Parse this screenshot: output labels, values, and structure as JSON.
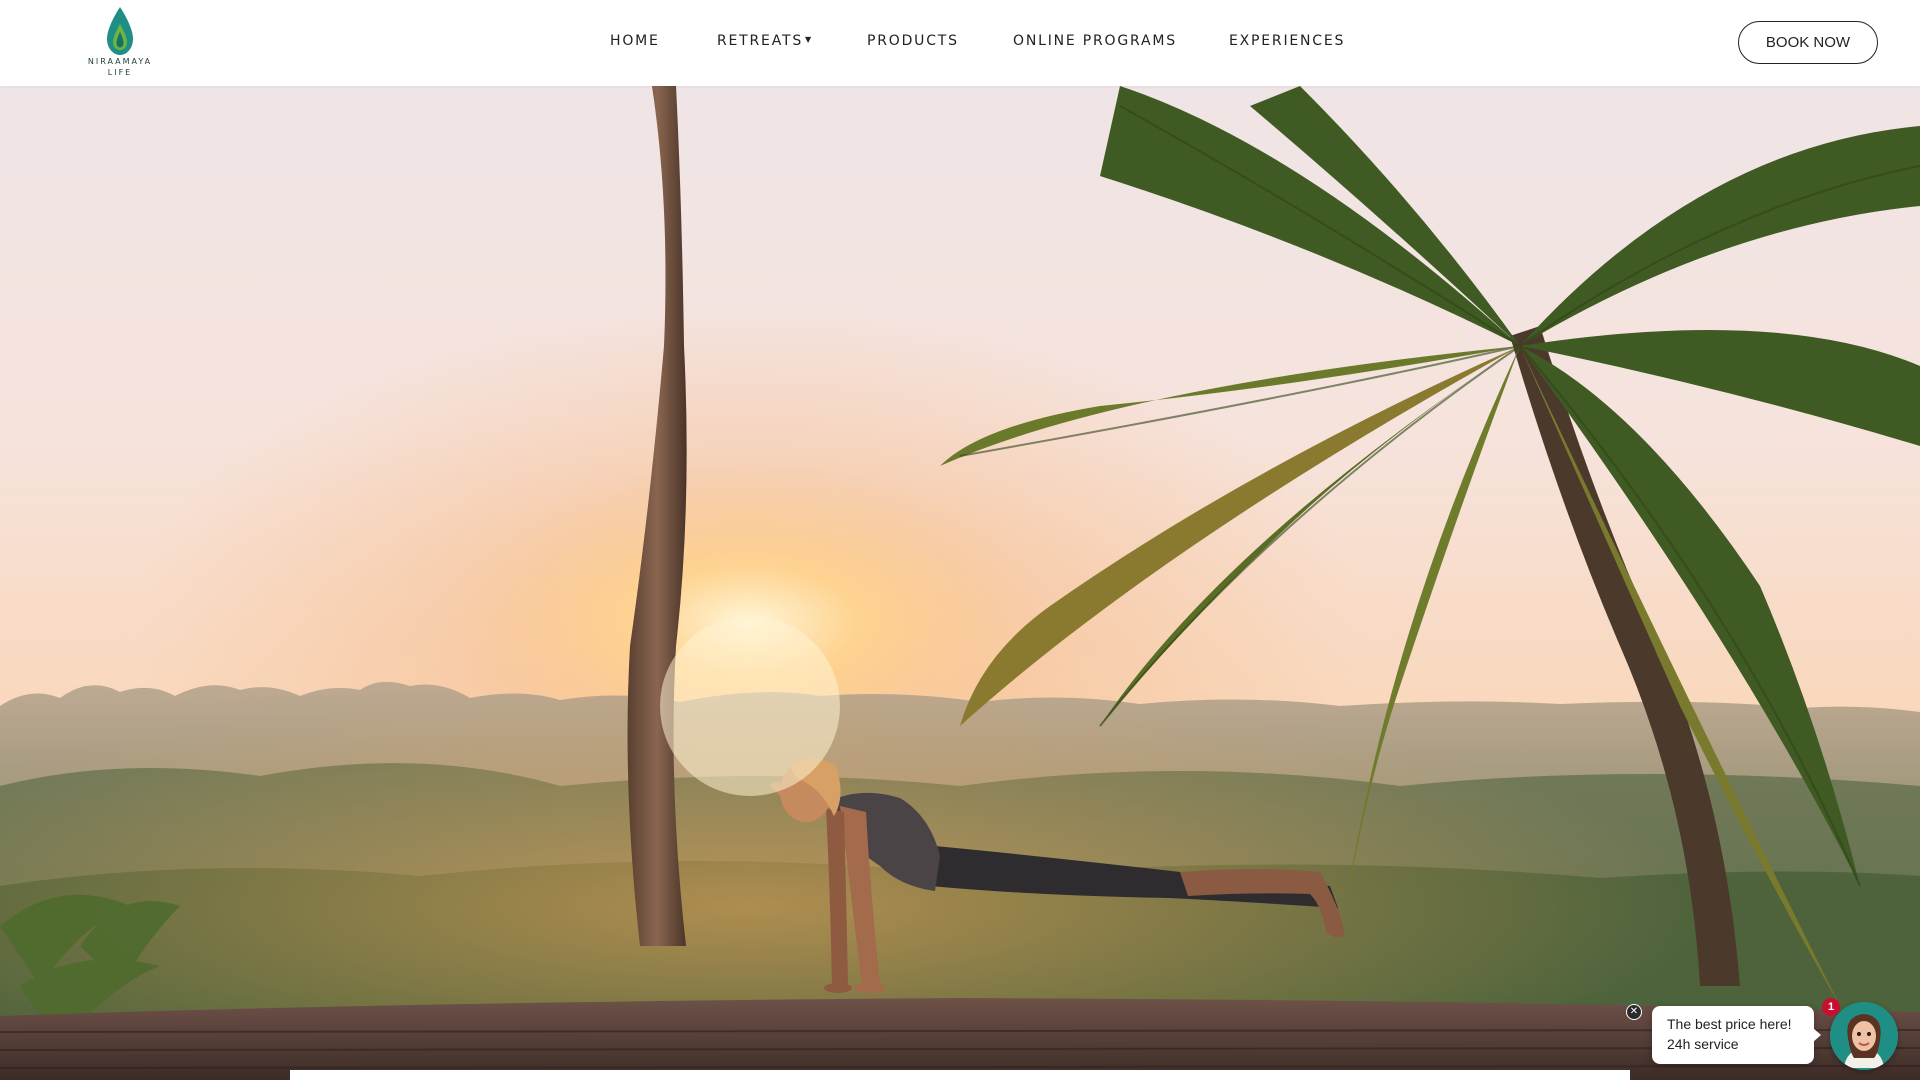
{
  "brand": {
    "name": "NIRAAMAYA",
    "sub": "LIFE",
    "logo_icon": "water-drop-logo",
    "colors": {
      "teal": "#1f8f85",
      "green": "#6db33f"
    }
  },
  "nav": {
    "items": [
      {
        "label": "HOME"
      },
      {
        "label": "RETREATS",
        "has_dropdown": true
      },
      {
        "label": "PRODUCTS"
      },
      {
        "label": "ONLINE PROGRAMS"
      },
      {
        "label": "EXPERIENCES"
      }
    ],
    "dropdown_icon": "caret-down-icon",
    "book_label": "BOOK NOW"
  },
  "hero": {
    "scene": "yoga at sunrise among palm trees above jungle valley"
  },
  "chat": {
    "line1": "The best price here!",
    "line2": "24h service",
    "badge_count": "1",
    "close_icon": "close-icon",
    "avatar_icon": "assistant-avatar-icon"
  }
}
